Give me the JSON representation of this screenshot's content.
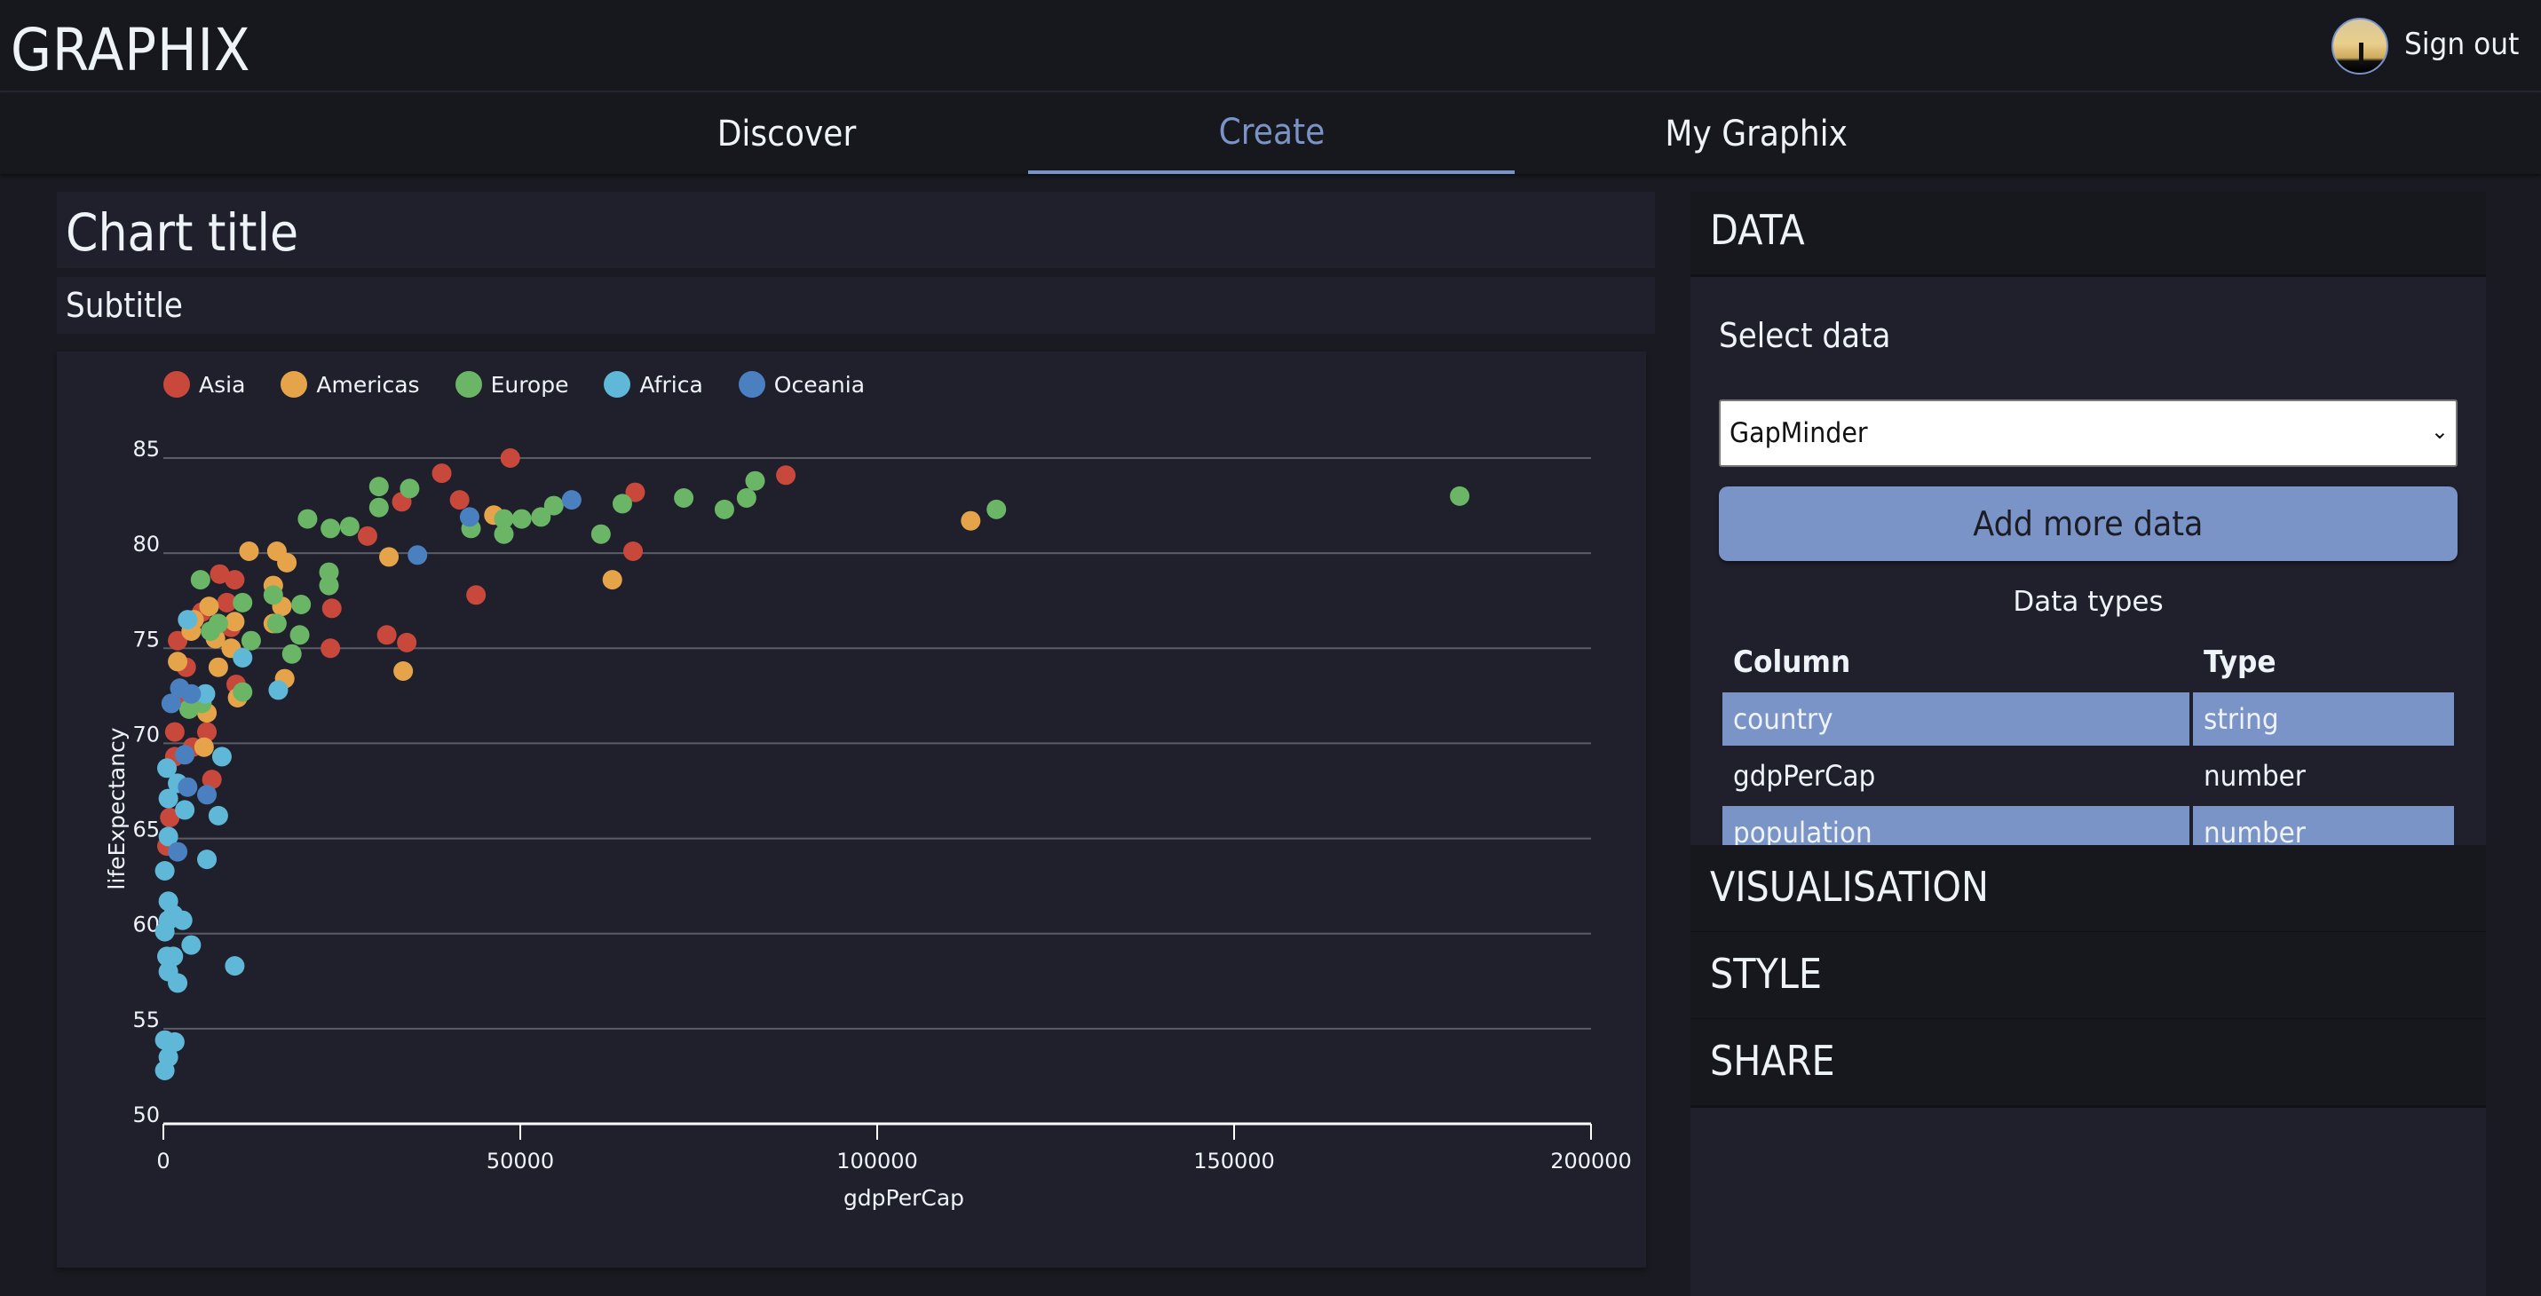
{
  "app": {
    "logo": "GRAPHIX",
    "sign_out_label": "Sign out",
    "avatar_alt": "user avatar"
  },
  "nav": {
    "tabs": [
      {
        "label": "Discover",
        "active": false
      },
      {
        "label": "Create",
        "active": true
      },
      {
        "label": "My Graphix",
        "active": false
      }
    ]
  },
  "editor": {
    "title": "Chart title",
    "subtitle": "Subtitle"
  },
  "panel": {
    "sections": {
      "data": "DATA",
      "visualisation": "VISUALISATION",
      "style": "STYLE",
      "share": "SHARE"
    },
    "select_label": "Select data",
    "dataset_value": "GapMinder",
    "add_more_label": "Add more data",
    "data_types_title": "Data types",
    "table": {
      "headers": [
        "Column",
        "Type"
      ],
      "rows": [
        [
          "country",
          "string"
        ],
        [
          "gdpPerCap",
          "number"
        ],
        [
          "population",
          "number"
        ]
      ]
    }
  },
  "colors": {
    "accent": "#7a94c7",
    "Asia": "#c9483c",
    "Americas": "#e6a44a",
    "Europe": "#6ab566",
    "Africa": "#60b8d8",
    "Oceania": "#4a80c0"
  },
  "chart_data": {
    "type": "scatter",
    "title": "Chart title",
    "subtitle": "Subtitle",
    "xlabel": "gdpPerCap",
    "ylabel": "lifeExpectancy",
    "xlim": [
      0,
      200000
    ],
    "ylim": [
      50,
      85
    ],
    "xticks": [
      "0",
      "50000",
      "100000",
      "150000",
      "200000"
    ],
    "yticks": [
      "50",
      "55",
      "60",
      "65",
      "70",
      "75",
      "80",
      "85"
    ],
    "xtick_values": [
      0,
      50000,
      100000,
      150000,
      200000
    ],
    "ytick_values": [
      50,
      55,
      60,
      65,
      70,
      75,
      80,
      85
    ],
    "grid": "horizontal",
    "legend_position": "top-left",
    "series": [
      {
        "name": "Asia",
        "points": [
          [
            48600,
            85.0
          ],
          [
            39000,
            84.2
          ],
          [
            87200,
            84.1
          ],
          [
            41500,
            82.8
          ],
          [
            66100,
            83.2
          ],
          [
            33400,
            82.7
          ],
          [
            28600,
            80.9
          ],
          [
            65800,
            80.1
          ],
          [
            43800,
            77.8
          ],
          [
            23600,
            77.1
          ],
          [
            31300,
            75.7
          ],
          [
            34100,
            75.3
          ],
          [
            23400,
            75.0
          ],
          [
            7900,
            78.9
          ],
          [
            10000,
            78.6
          ],
          [
            8900,
            77.4
          ],
          [
            5400,
            76.9
          ],
          [
            9500,
            76.1
          ],
          [
            2000,
            75.4
          ],
          [
            3200,
            74.0
          ],
          [
            10200,
            73.1
          ],
          [
            2500,
            72.3
          ],
          [
            1600,
            70.6
          ],
          [
            4100,
            69.8
          ],
          [
            6100,
            70.6
          ],
          [
            6800,
            68.1
          ],
          [
            900,
            66.1
          ],
          [
            500,
            64.6
          ],
          [
            1600,
            69.3
          ]
        ]
      },
      {
        "name": "Americas",
        "points": [
          [
            46300,
            82.0
          ],
          [
            113100,
            81.7
          ],
          [
            12000,
            80.1
          ],
          [
            15900,
            80.1
          ],
          [
            31600,
            79.8
          ],
          [
            62900,
            78.6
          ],
          [
            33600,
            73.8
          ],
          [
            17300,
            79.5
          ],
          [
            15400,
            78.3
          ],
          [
            16600,
            77.2
          ],
          [
            15400,
            76.3
          ],
          [
            10000,
            76.4
          ],
          [
            6400,
            77.2
          ],
          [
            4300,
            76.5
          ],
          [
            7300,
            75.5
          ],
          [
            2000,
            74.3
          ],
          [
            7700,
            74.0
          ],
          [
            9500,
            75.0
          ],
          [
            17000,
            73.4
          ],
          [
            6100,
            71.6
          ],
          [
            10400,
            72.4
          ],
          [
            5700,
            69.8
          ],
          [
            3900,
            75.9
          ]
        ]
      },
      {
        "name": "Europe",
        "points": [
          [
            30200,
            83.5
          ],
          [
            34500,
            83.4
          ],
          [
            30200,
            82.4
          ],
          [
            20200,
            81.8
          ],
          [
            23400,
            81.3
          ],
          [
            26100,
            81.4
          ],
          [
            43100,
            81.3
          ],
          [
            47700,
            81.8
          ],
          [
            47700,
            81.0
          ],
          [
            50200,
            81.8
          ],
          [
            52900,
            81.9
          ],
          [
            54700,
            82.5
          ],
          [
            64300,
            82.6
          ],
          [
            61300,
            81.0
          ],
          [
            72900,
            82.9
          ],
          [
            78600,
            82.3
          ],
          [
            81700,
            82.9
          ],
          [
            82900,
            83.8
          ],
          [
            116700,
            82.3
          ],
          [
            181600,
            83.0
          ],
          [
            23200,
            79.0
          ],
          [
            23200,
            78.3
          ],
          [
            15400,
            77.8
          ],
          [
            19300,
            77.3
          ],
          [
            11100,
            77.4
          ],
          [
            19100,
            75.7
          ],
          [
            18000,
            74.7
          ],
          [
            5200,
            78.6
          ],
          [
            6600,
            75.9
          ],
          [
            7700,
            76.3
          ],
          [
            12300,
            75.4
          ],
          [
            11100,
            72.7
          ],
          [
            3600,
            71.8
          ],
          [
            5400,
            72.1
          ],
          [
            15900,
            76.3
          ]
        ]
      },
      {
        "name": "Africa",
        "points": [
          [
            3400,
            76.5
          ],
          [
            11100,
            74.5
          ],
          [
            16100,
            72.8
          ],
          [
            5900,
            72.6
          ],
          [
            500,
            68.7
          ],
          [
            8200,
            69.3
          ],
          [
            2000,
            67.9
          ],
          [
            700,
            67.1
          ],
          [
            3000,
            66.5
          ],
          [
            7700,
            66.2
          ],
          [
            6100,
            63.9
          ],
          [
            700,
            65.1
          ],
          [
            200,
            63.3
          ],
          [
            700,
            61.7
          ],
          [
            700,
            60.7
          ],
          [
            200,
            60.1
          ],
          [
            2700,
            60.7
          ],
          [
            3900,
            59.4
          ],
          [
            500,
            58.8
          ],
          [
            1400,
            58.8
          ],
          [
            700,
            58.0
          ],
          [
            2000,
            57.4
          ],
          [
            10000,
            58.3
          ],
          [
            200,
            54.4
          ],
          [
            1600,
            54.3
          ],
          [
            700,
            53.5
          ],
          [
            200,
            52.8
          ],
          [
            1400,
            61.0
          ]
        ]
      },
      {
        "name": "Oceania",
        "points": [
          [
            57200,
            82.8
          ],
          [
            42900,
            81.9
          ],
          [
            35600,
            79.9
          ],
          [
            2300,
            72.9
          ],
          [
            3900,
            72.6
          ],
          [
            1100,
            72.1
          ],
          [
            3000,
            69.4
          ],
          [
            3400,
            67.7
          ],
          [
            6100,
            67.3
          ],
          [
            2000,
            64.3
          ]
        ]
      }
    ]
  }
}
